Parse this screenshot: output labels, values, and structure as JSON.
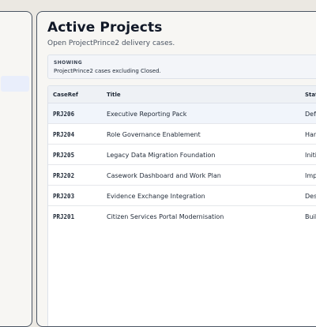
{
  "header": {
    "title": "Active Projects",
    "subtitle": "Open ProjectPrince2 delivery cases."
  },
  "filter": {
    "label": "SHOWING",
    "text": "ProjectPrince2 cases excluding Closed."
  },
  "table": {
    "columns": [
      "CaseRef",
      "Title",
      "Stat"
    ],
    "rows": [
      {
        "ref": "PRJ206",
        "title": "Executive Reporting Pack",
        "status": "Def"
      },
      {
        "ref": "PRJ204",
        "title": "Role Governance Enablement",
        "status": "Har"
      },
      {
        "ref": "PRJ205",
        "title": "Legacy Data Migration Foundation",
        "status": "Initi"
      },
      {
        "ref": "PRJ202",
        "title": "Casework Dashboard and Work Plan",
        "status": "Imp"
      },
      {
        "ref": "PRJ203",
        "title": "Evidence Exchange Integration",
        "status": "Des"
      },
      {
        "ref": "PRJ201",
        "title": "Citizen Services Portal Modernisation",
        "status": "Buil"
      }
    ]
  },
  "colors": {
    "accent_row": "#f1f5fb",
    "border": "#4b5563"
  }
}
